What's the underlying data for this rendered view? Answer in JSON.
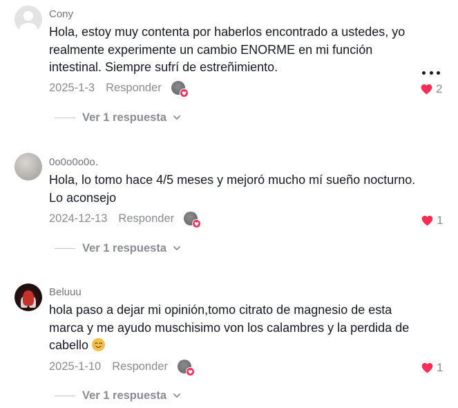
{
  "colors": {
    "text_primary": "#161823",
    "text_secondary": "#8a8b91",
    "like_red": "#fe2c55",
    "background": "#ffffff"
  },
  "comments": [
    {
      "username": "Cony",
      "avatar_icon": "default-avatar-icon",
      "text": "Hola, estoy muy contenta por haberlos encontrado a ustedes, yo realmente experimente un cambio ENORME en mi función intestinal. Siempre sufrí de estreñimiento.",
      "date": "2025-1-3",
      "reply_label": "Responder",
      "view_replies": "Ver 1 respuesta",
      "likes": "2",
      "liked": true
    },
    {
      "username": "0o0o0o0o.",
      "avatar_icon": "user-avatar-gray",
      "text": "Hola, lo tomo hace 4/5 meses y mejoró mucho mí sueño nocturno. Lo aconsejo",
      "date": "2024-12-13",
      "reply_label": "Responder",
      "view_replies": "Ver 1 respuesta",
      "likes": "1",
      "liked": true
    },
    {
      "username": "Beluuu",
      "avatar_icon": "user-avatar-dark",
      "text": "hola paso a dejar mi opinión,tomo citrato de magnesio de esta marca y me ayudo muschisimo von los calambres y la perdida de cabello",
      "emoji": "smiling-face-icon",
      "date": "2025-1-10",
      "reply_label": "Responder",
      "view_replies": "Ver 1 respuesta",
      "likes": "1",
      "liked": true
    }
  ],
  "more_options_icon": "more-horizontal-icon"
}
